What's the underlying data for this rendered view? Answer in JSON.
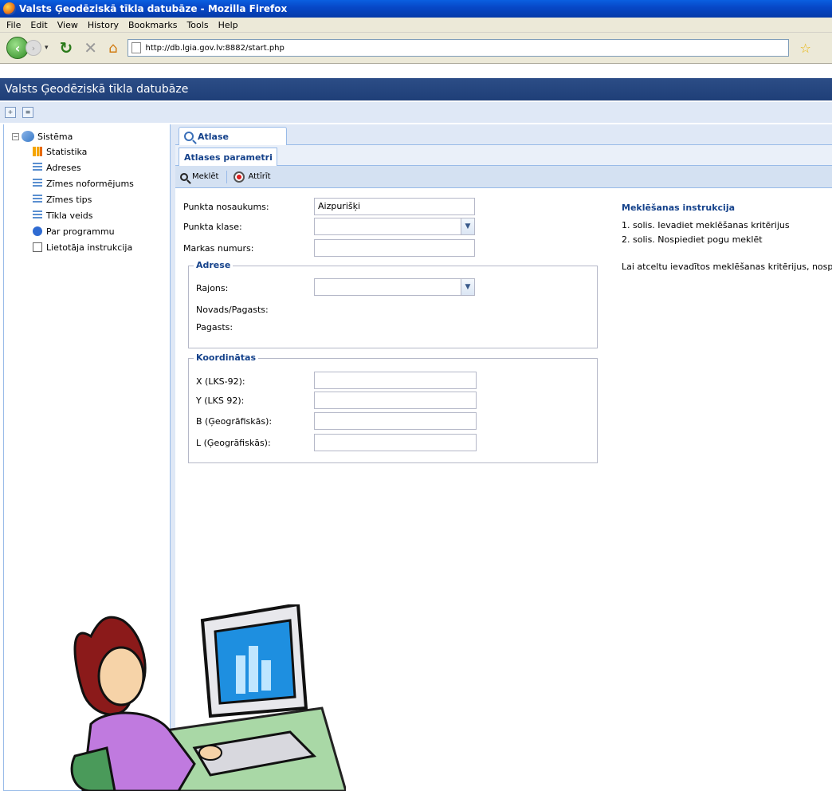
{
  "window": {
    "title": "Valsts Ģeodēziskā tīkla datubāze - Mozilla Firefox"
  },
  "menu": [
    "File",
    "Edit",
    "View",
    "History",
    "Bookmarks",
    "Tools",
    "Help"
  ],
  "browser": {
    "url": "http://db.lgia.gov.lv:8882/start.php"
  },
  "app": {
    "title": "Valsts Ģeodēziskā tīkla datubāze"
  },
  "tree": {
    "root": "Sistēma",
    "items": [
      {
        "label": "Statistika",
        "icon": "chart-icon"
      },
      {
        "label": "Adreses",
        "icon": "list-icon"
      },
      {
        "label": "Zīmes noformējums",
        "icon": "list-icon"
      },
      {
        "label": "Zīmes tips",
        "icon": "list-icon"
      },
      {
        "label": "Tīkla veids",
        "icon": "list-icon"
      },
      {
        "label": "Par programmu",
        "icon": "info-icon"
      },
      {
        "label": "Lietotāja instrukcija",
        "icon": "document-icon"
      }
    ]
  },
  "tabs": {
    "main": "Atlase",
    "sub": "Atlases parametri"
  },
  "actions": {
    "search": "Meklēt",
    "clear": "Attīrīt"
  },
  "form": {
    "point_name_label": "Punkta nosaukums:",
    "point_name_value": "Aizpurišķi",
    "point_class_label": "Punkta klase:",
    "mark_number_label": "Markas numurs:",
    "address_legend": "Adrese",
    "district_label": "Rajons:",
    "county_label": "Novads/Pagasts:",
    "parish_label": "Pagasts:",
    "coords_legend": "Koordinātas",
    "x_label": "X (LKS-92):",
    "y_label": "Y (LKS 92):",
    "b_label": "B (Ģeogrāfiskās):",
    "l_label": "L (Ģeogrāfiskās):"
  },
  "instructions": {
    "title": "Meklēšanas instrukcija",
    "step1": "1. solis. Ievadiet meklēšanas kritērijus",
    "step2": "2. solis. Nospiediet pogu meklēt",
    "note": "Lai atceltu ievadītos meklēšanas kritērijus, nospie"
  },
  "colors": {
    "header": "#1f3f78",
    "accent": "#15428b",
    "border": "#99bbe8"
  }
}
